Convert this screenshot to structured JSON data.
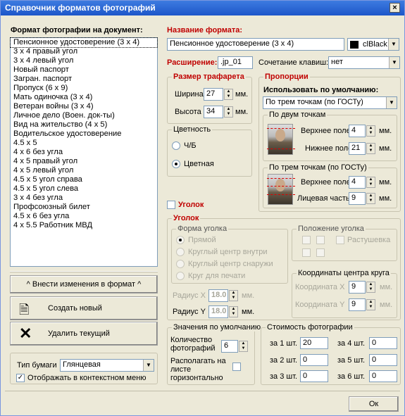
{
  "title": "Справочник форматов фотографий",
  "close_glyph": "×",
  "left": {
    "list_label": "Формат фотографии на документ:",
    "items": [
      "Пенсионное удостоверение (3 х 4)",
      "3 х 4 правый угол",
      "3 х 4 левый угол",
      "Новый паспорт",
      "Загран. паспорт",
      "Пропуск (6 х 9)",
      "Мать одиночка (3 х 4)",
      "Ветеран войны (3 х 4)",
      "Личное дело (Воен. док-ты)",
      "Вид на жительство (4 х 5)",
      "Водительское удостоверение",
      "4.5 х 5",
      "4 х 6 без угла",
      "4 х 5 правый угол",
      "4 х 5 левый угол",
      "4.5 х 5 угол справа",
      "4.5 х 5 угол слева",
      "3 х 4 без угла",
      "Профсоюзный билет",
      "4.5 х 6 без угла",
      "4 х 5.5 Работник МВД"
    ],
    "apply_btn": "^  Внести изменения в формат  ^",
    "create_btn": "Создать новый",
    "delete_btn": "Удалить текущий",
    "paper_label": "Тип бумаги",
    "paper_value": "Глянцевая",
    "context_label": "Отображать в контекстном меню"
  },
  "right": {
    "name_label": "Название формата:",
    "name_value": "Пенсионное удостоверение (3 х 4)",
    "color_value": "clBlack",
    "ext_label": "Расширение:",
    "ext_value": ".jp_01",
    "hotkey_label": "Сочетание клавиш:",
    "hotkey_value": "нет",
    "size_title": "Размер трафарета",
    "width_label": "Ширина",
    "width_value": "27",
    "mm": "мм.",
    "height_label": "Высота",
    "height_value": "34",
    "color_title": "Цветность",
    "bw_label": "Ч/Б",
    "color_label": "Цветная",
    "prop_title": "Пропорции",
    "default_label": "Использовать по умолчанию:",
    "default_value": "По трем точкам (по ГОСТу)",
    "two_title": "По двум точкам",
    "top_label": "Верхнее поле",
    "top_value": "4",
    "bottom_label": "Нижнее поле",
    "bottom_value": "21",
    "three_title": "По трем точкам (по ГОСТу)",
    "top3_value": "4",
    "face_label": "Лицевая часть",
    "face_value": "9",
    "corner_chk": "Уголок",
    "corner_title": "Уголок",
    "form_title": "Форма уголка",
    "forms": [
      "Прямой",
      "Круглый центр внутри",
      "Круглый центр снаружи",
      "Круг для печати"
    ],
    "pos_title": "Положение уголка",
    "shade_label": "Растушевка",
    "radx_label": "Радиус X",
    "rady_label": "Радиус Y",
    "rad_value": "18.0",
    "coord_title": "Координаты центра круга",
    "cx_label": "Координата X",
    "cy_label": "Координата Y",
    "c_value": "9",
    "defaults_title": "Значения по умолчанию",
    "qty_label": "Количество фотографий",
    "qty_value": "6",
    "horiz_label": "Располагать на листе горизонтально",
    "cost_title": "Стоимость фотографии",
    "costs": [
      {
        "label": "за 1 шт.",
        "value": "20"
      },
      {
        "label": "за 2 шт.",
        "value": "0"
      },
      {
        "label": "за 3 шт.",
        "value": "0"
      },
      {
        "label": "за 4 шт.",
        "value": "0"
      },
      {
        "label": "за 5 шт.",
        "value": "0"
      },
      {
        "label": "за 6 шт.",
        "value": "0"
      }
    ],
    "ok_btn": "Ок"
  }
}
